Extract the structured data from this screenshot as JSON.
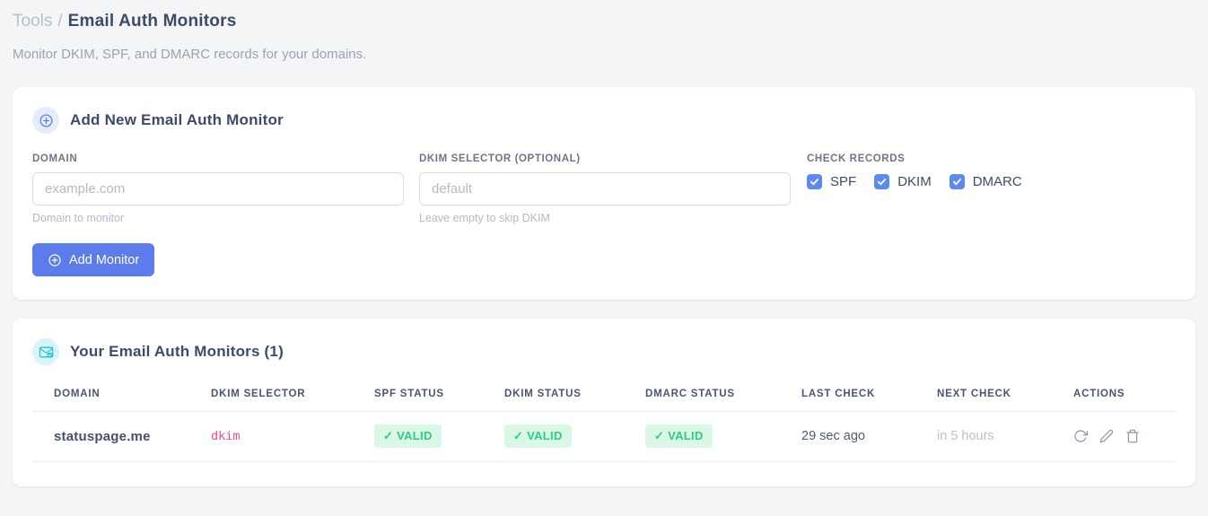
{
  "page": {
    "breadcrumb_root": "Tools",
    "breadcrumb_separator": "/",
    "title": "Email Auth Monitors",
    "subtitle": "Monitor DKIM, SPF, and DMARC records for your domains."
  },
  "add_card": {
    "title": "Add New Email Auth Monitor",
    "domain_field": {
      "label": "DOMAIN",
      "placeholder": "example.com",
      "value": "",
      "helper": "Domain to monitor"
    },
    "dkim_field": {
      "label": "DKIM SELECTOR (OPTIONAL)",
      "placeholder": "default",
      "value": "",
      "helper": "Leave empty to skip DKIM"
    },
    "check_records": {
      "label": "CHECK RECORDS",
      "options": [
        {
          "label": "SPF",
          "checked": true
        },
        {
          "label": "DKIM",
          "checked": true
        },
        {
          "label": "DMARC",
          "checked": true
        }
      ]
    },
    "submit_label": "Add Monitor"
  },
  "monitors_card": {
    "title": "Your Email Auth Monitors (1)",
    "table": {
      "headers": [
        "DOMAIN",
        "DKIM SELECTOR",
        "SPF STATUS",
        "DKIM STATUS",
        "DMARC STATUS",
        "LAST CHECK",
        "NEXT CHECK",
        "ACTIONS"
      ],
      "rows": [
        {
          "domain": "statuspage.me",
          "dkim_selector": "dkim",
          "spf_status": "✓ VALID",
          "dkim_status": "✓ VALID",
          "dmarc_status": "✓ VALID",
          "last_check": "29 sec ago",
          "next_check": "in 5 hours",
          "actions": [
            "refresh",
            "edit",
            "delete"
          ]
        }
      ]
    }
  },
  "colors": {
    "accent_blue": "#5b7cea",
    "checkbox_blue": "#5c8af0",
    "success_text": "#2ecc80",
    "success_bg": "#d9f8e6",
    "selector_pink": "#ed4e8c",
    "icon_badge_blue_bg": "#e5ecfc",
    "icon_badge_cyan_bg": "#d9f5f9",
    "cyan": "#21c4da",
    "page_bg": "#f4f5f7"
  }
}
